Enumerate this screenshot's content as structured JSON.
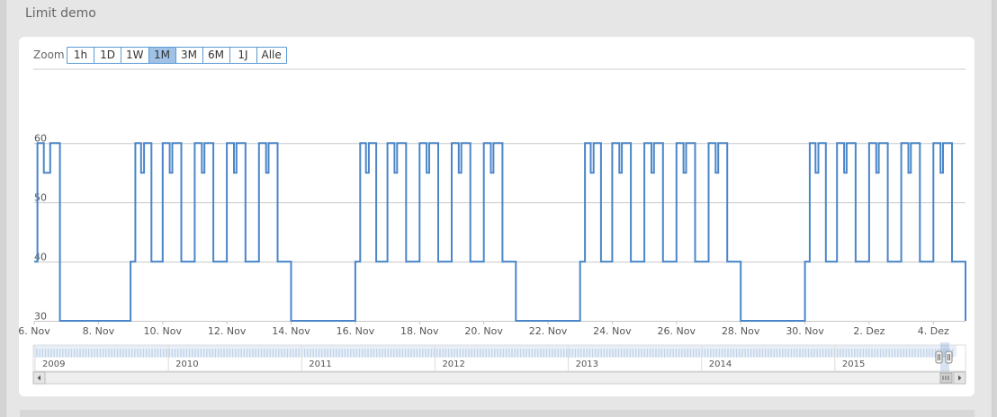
{
  "panel": {
    "title": "Limit demo"
  },
  "zoom": {
    "label": "Zoom",
    "buttons": [
      "1h",
      "1D",
      "1W",
      "1M",
      "3M",
      "6M",
      "1J",
      "Alle"
    ],
    "active": "1M"
  },
  "chart_data": {
    "type": "line",
    "step": true,
    "x_unit": "day-of-range",
    "x_start_day": 6.0,
    "x_end_day": 35.0,
    "ylim": [
      30,
      62
    ],
    "yticks": [
      30,
      40,
      50,
      60
    ],
    "xticks": [
      "6. Nov",
      "8. Nov",
      "10. Nov",
      "12. Nov",
      "14. Nov",
      "16. Nov",
      "18. Nov",
      "20. Nov",
      "22. Nov",
      "24. Nov",
      "26. Nov",
      "28. Nov",
      "30. Nov",
      "2. Dez",
      "4. Dez"
    ],
    "xtick_days": [
      6,
      8,
      10,
      12,
      14,
      16,
      18,
      20,
      22,
      24,
      26,
      28,
      30,
      32,
      34
    ],
    "series": [
      {
        "color": "#4a86c8",
        "values": [
          [
            6.0,
            40
          ],
          [
            6.1,
            40
          ],
          [
            6.1,
            60
          ],
          [
            6.3,
            60
          ],
          [
            6.3,
            55
          ],
          [
            6.5,
            55
          ],
          [
            6.5,
            60
          ],
          [
            6.8,
            60
          ],
          [
            6.8,
            30
          ],
          [
            9.0,
            30
          ],
          [
            9.0,
            40
          ],
          [
            9.15,
            40
          ],
          [
            9.15,
            60
          ],
          [
            9.33,
            60
          ],
          [
            9.33,
            55
          ],
          [
            9.42,
            55
          ],
          [
            9.42,
            60
          ],
          [
            9.65,
            60
          ],
          [
            9.65,
            40
          ],
          [
            10.0,
            40
          ],
          [
            10.0,
            60
          ],
          [
            10.22,
            60
          ],
          [
            10.22,
            55
          ],
          [
            10.3,
            55
          ],
          [
            10.3,
            60
          ],
          [
            10.58,
            60
          ],
          [
            10.58,
            40
          ],
          [
            11.0,
            40
          ],
          [
            11.0,
            60
          ],
          [
            11.22,
            60
          ],
          [
            11.22,
            55
          ],
          [
            11.3,
            55
          ],
          [
            11.3,
            60
          ],
          [
            11.58,
            60
          ],
          [
            11.58,
            40
          ],
          [
            12.0,
            40
          ],
          [
            12.0,
            60
          ],
          [
            12.22,
            60
          ],
          [
            12.22,
            55
          ],
          [
            12.3,
            55
          ],
          [
            12.3,
            60
          ],
          [
            12.58,
            60
          ],
          [
            12.58,
            40
          ],
          [
            13.0,
            40
          ],
          [
            13.0,
            60
          ],
          [
            13.22,
            60
          ],
          [
            13.22,
            55
          ],
          [
            13.3,
            55
          ],
          [
            13.3,
            60
          ],
          [
            13.58,
            60
          ],
          [
            13.58,
            40
          ],
          [
            14.0,
            40
          ],
          [
            14.0,
            30
          ],
          [
            16.0,
            30
          ],
          [
            16.0,
            40
          ],
          [
            16.15,
            40
          ],
          [
            16.15,
            60
          ],
          [
            16.33,
            60
          ],
          [
            16.33,
            55
          ],
          [
            16.42,
            55
          ],
          [
            16.42,
            60
          ],
          [
            16.65,
            60
          ],
          [
            16.65,
            40
          ],
          [
            17.0,
            40
          ],
          [
            17.0,
            60
          ],
          [
            17.22,
            60
          ],
          [
            17.22,
            55
          ],
          [
            17.3,
            55
          ],
          [
            17.3,
            60
          ],
          [
            17.58,
            60
          ],
          [
            17.58,
            40
          ],
          [
            18.0,
            40
          ],
          [
            18.0,
            60
          ],
          [
            18.22,
            60
          ],
          [
            18.22,
            55
          ],
          [
            18.3,
            55
          ],
          [
            18.3,
            60
          ],
          [
            18.58,
            60
          ],
          [
            18.58,
            40
          ],
          [
            19.0,
            40
          ],
          [
            19.0,
            60
          ],
          [
            19.22,
            60
          ],
          [
            19.22,
            55
          ],
          [
            19.3,
            55
          ],
          [
            19.3,
            60
          ],
          [
            19.58,
            60
          ],
          [
            19.58,
            40
          ],
          [
            20.0,
            40
          ],
          [
            20.0,
            60
          ],
          [
            20.22,
            60
          ],
          [
            20.22,
            55
          ],
          [
            20.3,
            55
          ],
          [
            20.3,
            60
          ],
          [
            20.58,
            60
          ],
          [
            20.58,
            40
          ],
          [
            21.0,
            40
          ],
          [
            21.0,
            30
          ],
          [
            23.0,
            30
          ],
          [
            23.0,
            40
          ],
          [
            23.15,
            40
          ],
          [
            23.15,
            60
          ],
          [
            23.33,
            60
          ],
          [
            23.33,
            55
          ],
          [
            23.42,
            55
          ],
          [
            23.42,
            60
          ],
          [
            23.65,
            60
          ],
          [
            23.65,
            40
          ],
          [
            24.0,
            40
          ],
          [
            24.0,
            60
          ],
          [
            24.22,
            60
          ],
          [
            24.22,
            55
          ],
          [
            24.3,
            55
          ],
          [
            24.3,
            60
          ],
          [
            24.58,
            60
          ],
          [
            24.58,
            40
          ],
          [
            25.0,
            40
          ],
          [
            25.0,
            60
          ],
          [
            25.22,
            60
          ],
          [
            25.22,
            55
          ],
          [
            25.3,
            55
          ],
          [
            25.3,
            60
          ],
          [
            25.58,
            60
          ],
          [
            25.58,
            40
          ],
          [
            26.0,
            40
          ],
          [
            26.0,
            60
          ],
          [
            26.22,
            60
          ],
          [
            26.22,
            55
          ],
          [
            26.3,
            55
          ],
          [
            26.3,
            60
          ],
          [
            26.58,
            60
          ],
          [
            26.58,
            40
          ],
          [
            27.0,
            40
          ],
          [
            27.0,
            60
          ],
          [
            27.22,
            60
          ],
          [
            27.22,
            55
          ],
          [
            27.3,
            55
          ],
          [
            27.3,
            60
          ],
          [
            27.58,
            60
          ],
          [
            27.58,
            40
          ],
          [
            28.0,
            40
          ],
          [
            28.0,
            30
          ],
          [
            30.0,
            30
          ],
          [
            30.0,
            40
          ],
          [
            30.15,
            40
          ],
          [
            30.15,
            60
          ],
          [
            30.33,
            60
          ],
          [
            30.33,
            55
          ],
          [
            30.42,
            55
          ],
          [
            30.42,
            60
          ],
          [
            30.65,
            60
          ],
          [
            30.65,
            40
          ],
          [
            31.0,
            40
          ],
          [
            31.0,
            60
          ],
          [
            31.22,
            60
          ],
          [
            31.22,
            55
          ],
          [
            31.3,
            55
          ],
          [
            31.3,
            60
          ],
          [
            31.58,
            60
          ],
          [
            31.58,
            40
          ],
          [
            32.0,
            40
          ],
          [
            32.0,
            60
          ],
          [
            32.22,
            60
          ],
          [
            32.22,
            55
          ],
          [
            32.3,
            55
          ],
          [
            32.3,
            60
          ],
          [
            32.58,
            60
          ],
          [
            32.58,
            40
          ],
          [
            33.0,
            40
          ],
          [
            33.0,
            60
          ],
          [
            33.22,
            60
          ],
          [
            33.22,
            55
          ],
          [
            33.3,
            55
          ],
          [
            33.3,
            60
          ],
          [
            33.58,
            60
          ],
          [
            33.58,
            40
          ],
          [
            34.0,
            40
          ],
          [
            34.0,
            60
          ],
          [
            34.22,
            60
          ],
          [
            34.22,
            55
          ],
          [
            34.3,
            55
          ],
          [
            34.3,
            60
          ],
          [
            34.58,
            60
          ],
          [
            34.58,
            40
          ],
          [
            35.0,
            40
          ],
          [
            35.0,
            30
          ]
        ]
      }
    ],
    "navigator": {
      "years": [
        "2009",
        "2010",
        "2011",
        "2012",
        "2013",
        "2014",
        "2015"
      ],
      "year_positions": [
        0.0,
        0.143,
        0.286,
        0.429,
        0.572,
        0.715,
        0.858
      ]
    }
  },
  "icons": {
    "scroll_left": "arrow-left-icon",
    "scroll_right": "arrow-right-icon",
    "handle": "grip-icon"
  }
}
